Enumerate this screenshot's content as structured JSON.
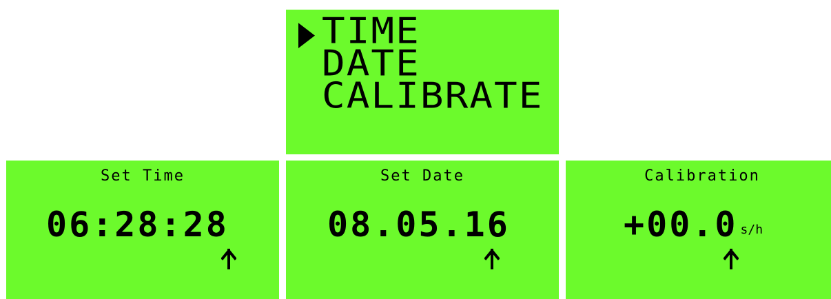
{
  "menu": {
    "items": [
      "TIME",
      "DATE",
      "CALIBRATE"
    ],
    "selected_index": 0
  },
  "time_screen": {
    "title": "Set Time",
    "value": "06:28:28"
  },
  "date_screen": {
    "title": "Set Date",
    "value": "08.05.16"
  },
  "calibration_screen": {
    "title": "Calibration",
    "value": "+00.0",
    "unit": "s/h"
  },
  "colors": {
    "lcd_background": "#6cfa2c",
    "lcd_text": "#000000"
  },
  "icons": {
    "menu_cursor": "triangle-right-icon",
    "edit_cursor": "up-arrow-icon"
  }
}
